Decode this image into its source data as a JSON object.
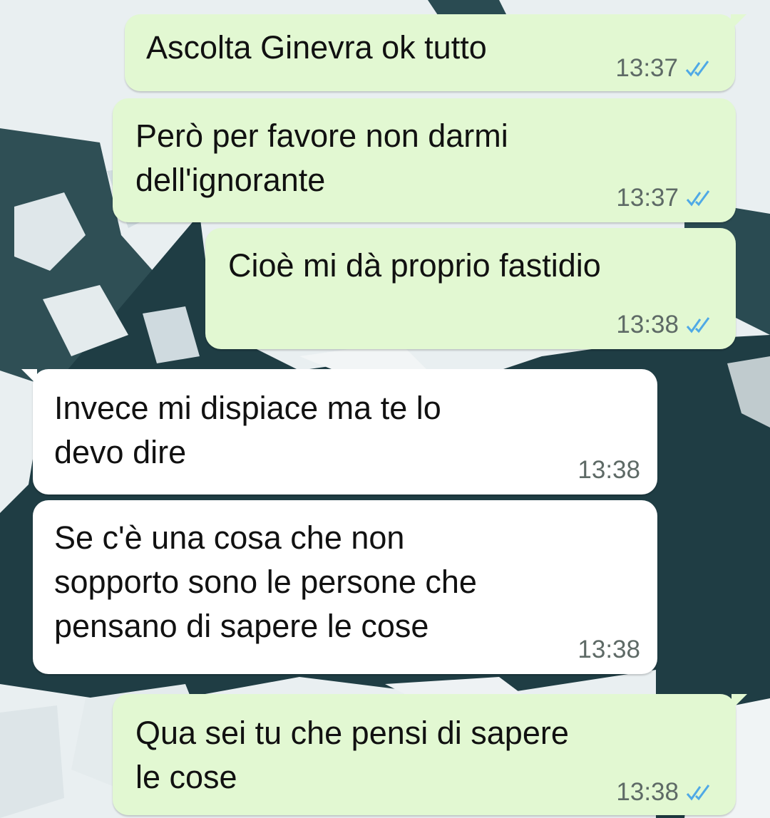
{
  "chat": {
    "messages": [
      {
        "direction": "outgoing",
        "text": "Ascolta Ginevra ok tutto",
        "time": "13:37",
        "status": "read"
      },
      {
        "direction": "outgoing",
        "text": "Però per favore non darmi\ndell'ignorante",
        "time": "13:37",
        "status": "read"
      },
      {
        "direction": "outgoing",
        "text": "Cioè mi dà proprio fastidio",
        "time": "13:38",
        "status": "read"
      },
      {
        "direction": "incoming",
        "text": "Invece mi dispiace ma te lo\ndevo dire",
        "time": "13:38"
      },
      {
        "direction": "incoming",
        "text": "Se c'è una cosa che non\nsopporto sono le persone che\npensano di sapere le cose",
        "time": "13:38"
      },
      {
        "direction": "outgoing",
        "text": "Qua sei tu che pensi di sapere\nle cose",
        "time": "13:38",
        "status": "read"
      }
    ]
  },
  "icons": {
    "read_receipt": "double-check-icon"
  },
  "colors": {
    "outgoing_bubble": "#e2f8d2",
    "incoming_bubble": "#ffffff",
    "read_tick": "#4fa9e6",
    "timestamp": "#5e6a66",
    "wallpaper_water": "#2f4f55",
    "wallpaper_ice": "#e8eef0"
  }
}
